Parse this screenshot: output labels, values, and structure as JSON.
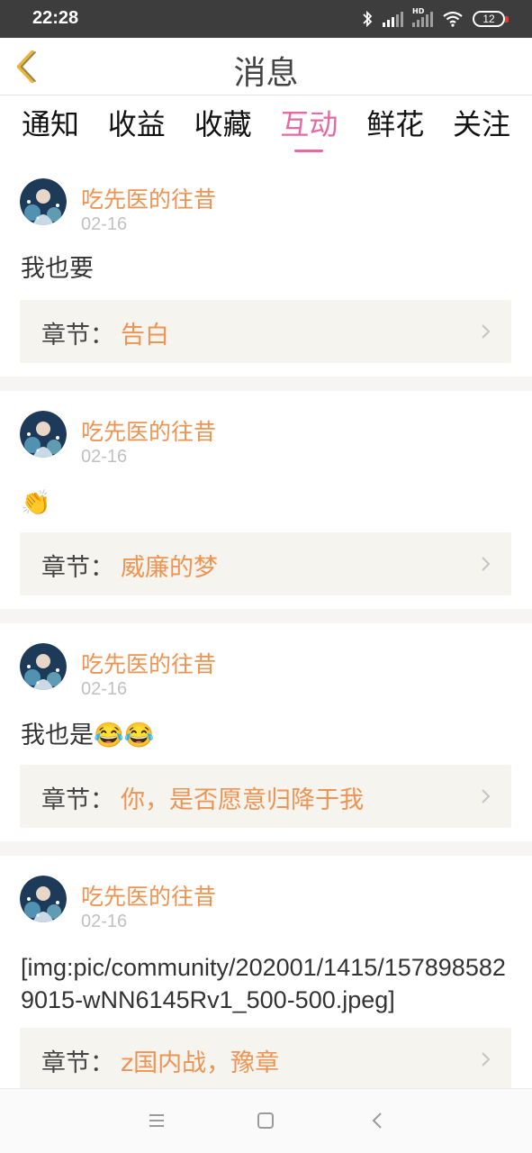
{
  "status_bar": {
    "time": "22:28",
    "network": "HD",
    "battery": "12"
  },
  "header": {
    "title": "消息",
    "back_icon": "chevron-left-icon"
  },
  "tabs": [
    {
      "label": "通知",
      "active": false
    },
    {
      "label": "收益",
      "active": false
    },
    {
      "label": "收藏",
      "active": false
    },
    {
      "label": "互动",
      "active": true
    },
    {
      "label": "鲜花",
      "active": false
    },
    {
      "label": "关注",
      "active": false
    }
  ],
  "chapter_label": "章节：",
  "messages": [
    {
      "username": "吃先医的往昔",
      "date": "02-16",
      "content": "我也要",
      "chapter": "告白"
    },
    {
      "username": "吃先医的往昔",
      "date": "02-16",
      "content": "👏",
      "chapter": "威廉的梦"
    },
    {
      "username": "吃先医的往昔",
      "date": "02-16",
      "content": "我也是😂😂",
      "chapter": "你，是否愿意归降于我"
    },
    {
      "username": "吃先医的往昔",
      "date": "02-16",
      "content": "[img:pic/community/202001/1415/1578985829015-wNN6145Rv1_500-500.jpeg]",
      "chapter": "z国内战，豫章"
    }
  ],
  "nav": {
    "menu_icon": "menu-icon",
    "home_icon": "square-home-icon",
    "back_icon": "back-triangle-icon"
  },
  "colors": {
    "accent_pink": "#e46aa3",
    "username_orange": "#ee9352",
    "chapter_bg": "#f5f4ef",
    "status_bar": "#3d3d3d"
  }
}
